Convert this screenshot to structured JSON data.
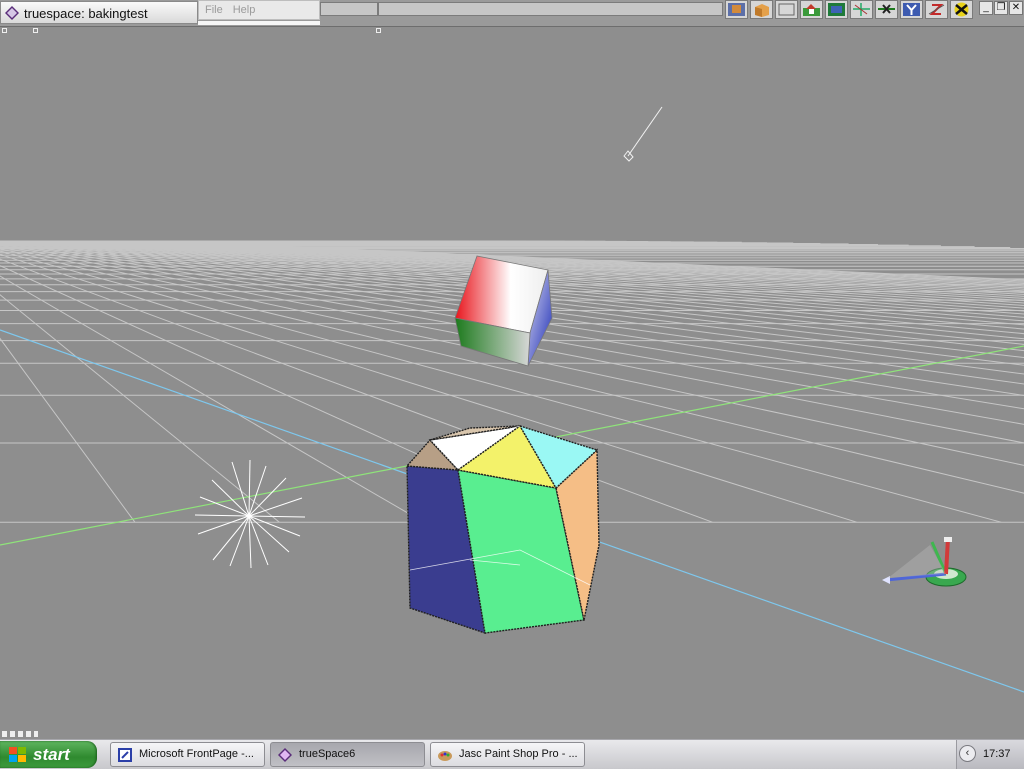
{
  "window": {
    "title": "truespace: bakingtest"
  },
  "menu": {
    "file": "File",
    "help": "Help"
  },
  "toolbar": {
    "icons": [
      "render-icon",
      "object-box-icon",
      "blank-icon",
      "scene-icon",
      "display-icon",
      "grid-icon",
      "x-axis-icon",
      "y-axis-icon",
      "z-axis-icon",
      "snap-icon"
    ]
  },
  "window_controls": {
    "minimize": "_",
    "restore": "❐",
    "close": "✕"
  },
  "scene": {
    "objects": [
      "rgb-cube",
      "faceted-polyhedron",
      "omni-light",
      "spot-light",
      "navigation-widget"
    ],
    "colors": {
      "background": "#8e8e8e",
      "grid": "#c8c8c8",
      "x_axis": "#7ec8ee",
      "z_axis": "#8fe37a"
    }
  },
  "taskbar": {
    "start": "start",
    "tasks": [
      {
        "label": "Microsoft FrontPage -...",
        "icon": "frontpage-icon",
        "active": false
      },
      {
        "label": "trueSpace6",
        "icon": "truespace-icon",
        "active": true
      },
      {
        "label": "Jasc Paint Shop Pro - ...",
        "icon": "paintshop-icon",
        "active": false
      }
    ],
    "clock": "17:37"
  }
}
